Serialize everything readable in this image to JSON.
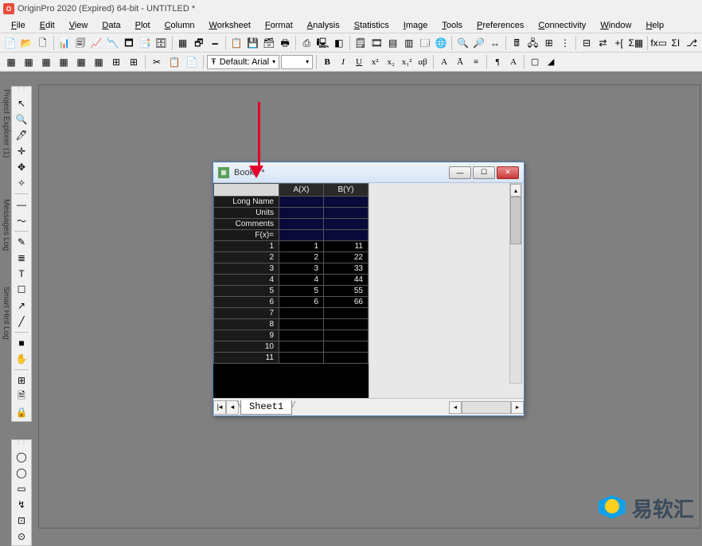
{
  "titlebar": {
    "app_icon_letter": "O",
    "title": "OriginPro 2020 (Expired) 64-bit - UNTITLED *"
  },
  "menu": {
    "items": [
      "File",
      "Edit",
      "View",
      "Data",
      "Plot",
      "Column",
      "Worksheet",
      "Format",
      "Analysis",
      "Statistics",
      "Image",
      "Tools",
      "Preferences",
      "Connectivity",
      "Window",
      "Help"
    ]
  },
  "toolbar1_icons": [
    "📄",
    "📂",
    "🗋",
    "📊",
    "🗐",
    "📈",
    "📉",
    "🗖",
    "📑",
    "🗄",
    "▦",
    "🗗",
    "🗕",
    "📋",
    "💾",
    "🗃",
    "🖶",
    "⎙",
    "🖳",
    "◧",
    "🗒",
    "🎞",
    "▤",
    "▥",
    "🗔",
    "🌐",
    "🔍",
    "🔎",
    "↔",
    "🖩",
    "🖧",
    "⊞",
    "⋮",
    "⊟",
    "⇄",
    "+[",
    "Σ▦",
    "fx▭",
    "ΣI",
    "⎇"
  ],
  "toolbar2": {
    "icons_left": [
      "▦",
      "▦",
      "▦",
      "▦",
      "▦",
      "▦",
      "⊞",
      "⊞"
    ],
    "icons_mid": [
      "✂",
      "📋",
      "📄"
    ],
    "font_label": "Default: Arial",
    "font_icon": "Ŧ",
    "size_value": "",
    "format_buttons": [
      "B",
      "I",
      "U",
      "x²",
      "x₂",
      "x₁²",
      "αβ",
      "A",
      "Ā",
      "≡",
      "¶",
      "A",
      "▢",
      "◢"
    ]
  },
  "side_labels": {
    "pe": "Project Explorer (1)",
    "ml": "Messages Log",
    "sh": "Smart Hint Log"
  },
  "vtoolbar1": [
    "↖",
    "🔍",
    "🖊",
    "✛",
    "✥",
    "✧",
    "—",
    "～",
    "✎",
    "≣",
    "T",
    "☐",
    "↗",
    "╱",
    "■",
    "✋",
    "⊞",
    "🗎",
    "🔒"
  ],
  "vtoolbar2": [
    "◯",
    "◯",
    "▭",
    "↯",
    "⊡",
    "⊙"
  ],
  "book": {
    "title": "Book1 *",
    "icon_letter": "▦",
    "columns": [
      "A(X)",
      "B(Y)"
    ],
    "labels": [
      "Long Name",
      "Units",
      "Comments",
      "F(x)="
    ],
    "rows": [
      {
        "n": "1",
        "a": "1",
        "b": "11"
      },
      {
        "n": "2",
        "a": "2",
        "b": "22"
      },
      {
        "n": "3",
        "a": "3",
        "b": "33"
      },
      {
        "n": "4",
        "a": "4",
        "b": "44"
      },
      {
        "n": "5",
        "a": "5",
        "b": "55"
      },
      {
        "n": "6",
        "a": "6",
        "b": "66"
      },
      {
        "n": "7",
        "a": "",
        "b": ""
      },
      {
        "n": "8",
        "a": "",
        "b": ""
      },
      {
        "n": "9",
        "a": "",
        "b": ""
      },
      {
        "n": "10",
        "a": "",
        "b": ""
      },
      {
        "n": "11",
        "a": "",
        "b": ""
      }
    ],
    "sheet_tab": "Sheet1",
    "win_btns": {
      "min": "—",
      "max": "☐",
      "close": "✕"
    },
    "nav": {
      "first": "|◂",
      "prev": "◂",
      "next": "▸",
      "last": "▸|"
    },
    "hscroll": {
      "left": "◂",
      "right": "▸"
    }
  },
  "watermark": {
    "text": "易软汇"
  }
}
